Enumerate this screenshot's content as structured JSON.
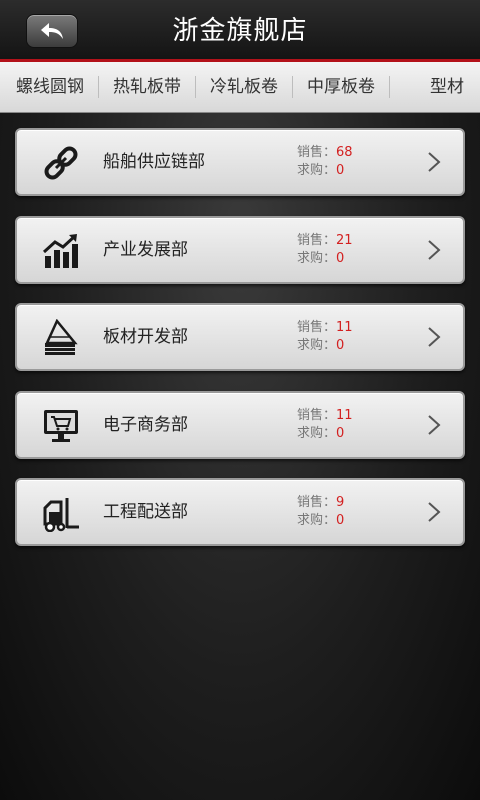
{
  "header": {
    "title": "浙金旗舰店",
    "back_icon": "back-arrow-icon"
  },
  "tabs": [
    "螺线圆钢",
    "热轧板带",
    "冷轧板卷",
    "中厚板卷",
    "型材"
  ],
  "stats_labels": {
    "sales": "销售：",
    "purchase": "求购："
  },
  "departments": [
    {
      "name": "船舶供应链部",
      "icon": "chain-link-icon",
      "sales": "68",
      "purchase": "0"
    },
    {
      "name": "产业发展部",
      "icon": "growth-chart-icon",
      "sales": "21",
      "purchase": "0"
    },
    {
      "name": "板材开发部",
      "icon": "stacked-plates-icon",
      "sales": "11",
      "purchase": "0"
    },
    {
      "name": "电子商务部",
      "icon": "computer-cart-icon",
      "sales": "11",
      "purchase": "0"
    },
    {
      "name": "工程配送部",
      "icon": "forklift-icon",
      "sales": "9",
      "purchase": "0"
    }
  ],
  "colors": {
    "accent_red": "#b3121a",
    "number_red": "#d32020"
  }
}
